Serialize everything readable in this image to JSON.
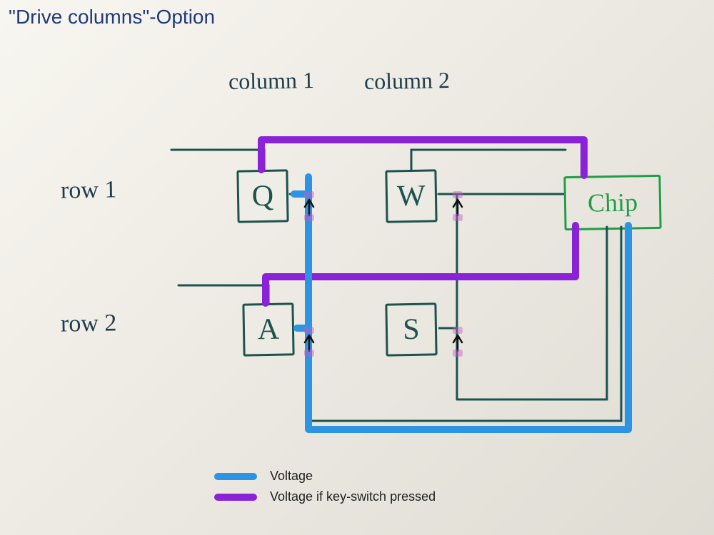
{
  "title": "\"Drive columns\"-Option",
  "columns": [
    "column 1",
    "column 2"
  ],
  "rows": [
    "row 1",
    "row 2"
  ],
  "keys": {
    "r1c1": "Q",
    "r1c2": "W",
    "r2c1": "A",
    "r2c2": "S"
  },
  "chip_label": "Chip",
  "legend": {
    "voltage": "Voltage",
    "voltage_pressed": "Voltage if key-switch pressed"
  },
  "colors": {
    "voltage": "#2d94e3",
    "voltage_pressed": "#8a22d8",
    "pen_darkgreen": "#1d524f",
    "pen_green": "#1f9e46",
    "title": "#203a7a"
  }
}
